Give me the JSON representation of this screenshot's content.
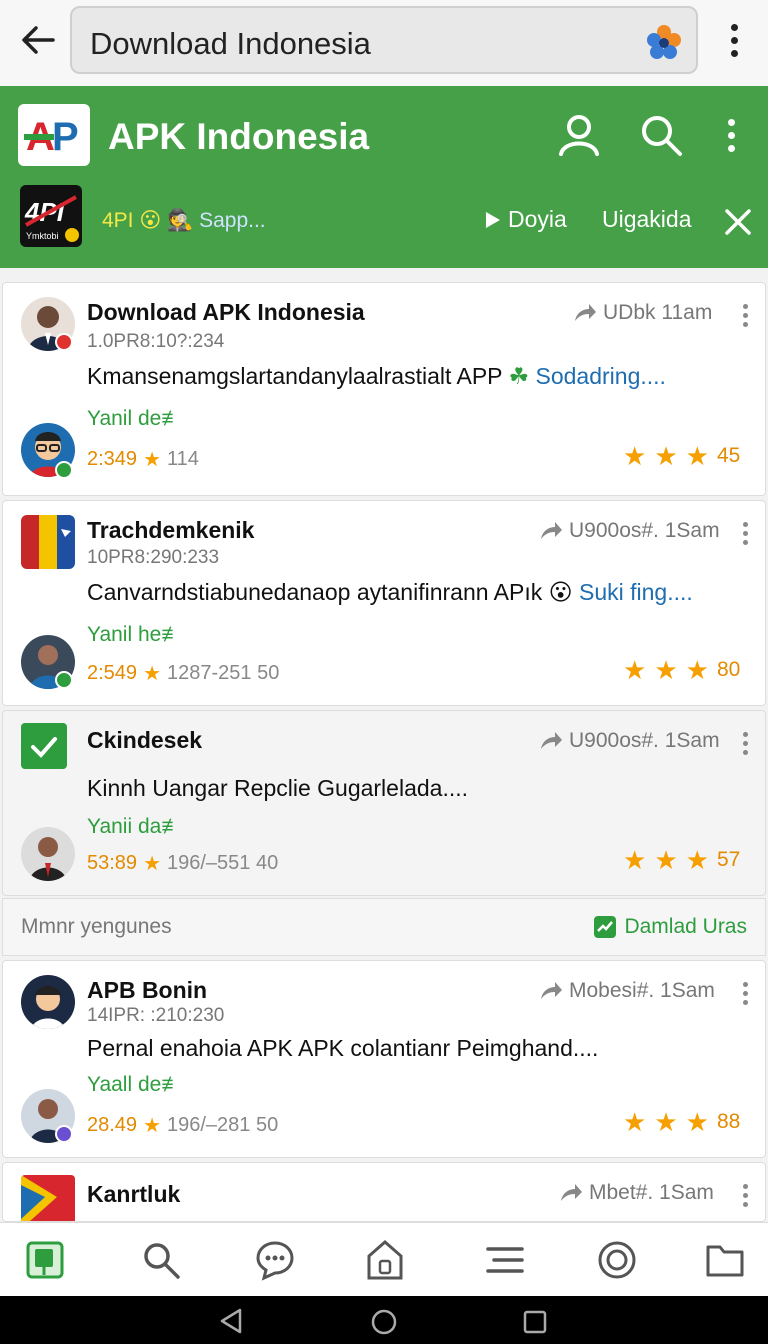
{
  "browser": {
    "url": "Download Indonesia",
    "back_icon": "back-arrow-icon",
    "menu_icon": "kebab-menu-icon"
  },
  "header": {
    "logo_text": "AP",
    "title": "APK Indonesia",
    "sub_logo_text": "4PI",
    "sub_logo_caption": "Ymktobi",
    "sub_left": "4PI",
    "sub_left_link": "Sapp...",
    "tab_play": "Doyia",
    "tab_other": "Uigakida",
    "colors": {
      "green": "#46a048",
      "accent_orange": "#e38a00",
      "tag_green": "#2e9d3e"
    }
  },
  "posts": [
    {
      "title": "Download APK Indonesia",
      "meta": "UDbk 11am",
      "code": "1.0PR8:10?:234",
      "desc": "Kmansenamgslartandanylaalrastialt APP",
      "desc_link": "Sodadring....",
      "tag": "Yanil de≢",
      "stat_value": "2:349",
      "stat_count": "114",
      "rating": "45"
    },
    {
      "title": "Trachdemkenik",
      "meta": "U900os#. 1Sam",
      "code": "10PR8:290:233",
      "desc": "Canvarndstiabunedanaop aytanifinrann APık",
      "desc_link": "Suki fing....",
      "tag": "Yanil he≢",
      "stat_value": "2:549",
      "stat_count": "1287-251  50",
      "rating": "80"
    },
    {
      "title": "Ckindesek",
      "meta": "U900os#. 1Sam",
      "desc": "Kinnh Uangar Repclie Gugarlelada....",
      "tag": "Yanii da≢",
      "stat_value": "53:89",
      "stat_count": "196/–551 40",
      "rating": "57"
    },
    {
      "title": "APB Bonin",
      "meta": "Mobesi#. 1Sam",
      "code": "14IPR: :210:230",
      "desc": "Pernal enahoia APK APK colantianr Peimghand....",
      "tag": "Yaall de≢",
      "stat_value": "28.49",
      "stat_count": "196/–281 50",
      "rating": "88"
    },
    {
      "title": "Kanrtluk",
      "meta": "Mbet#. 1Sam"
    }
  ],
  "section": {
    "left": "Mmnr yengunes",
    "right": "Damlad Uras"
  },
  "bottom_nav": [
    "home-app-icon",
    "search-icon",
    "chat-icon",
    "shield-icon",
    "list-icon",
    "target-icon",
    "folder-icon"
  ],
  "system_nav": [
    "back-triangle-icon",
    "home-circle-icon",
    "recents-square-icon"
  ]
}
